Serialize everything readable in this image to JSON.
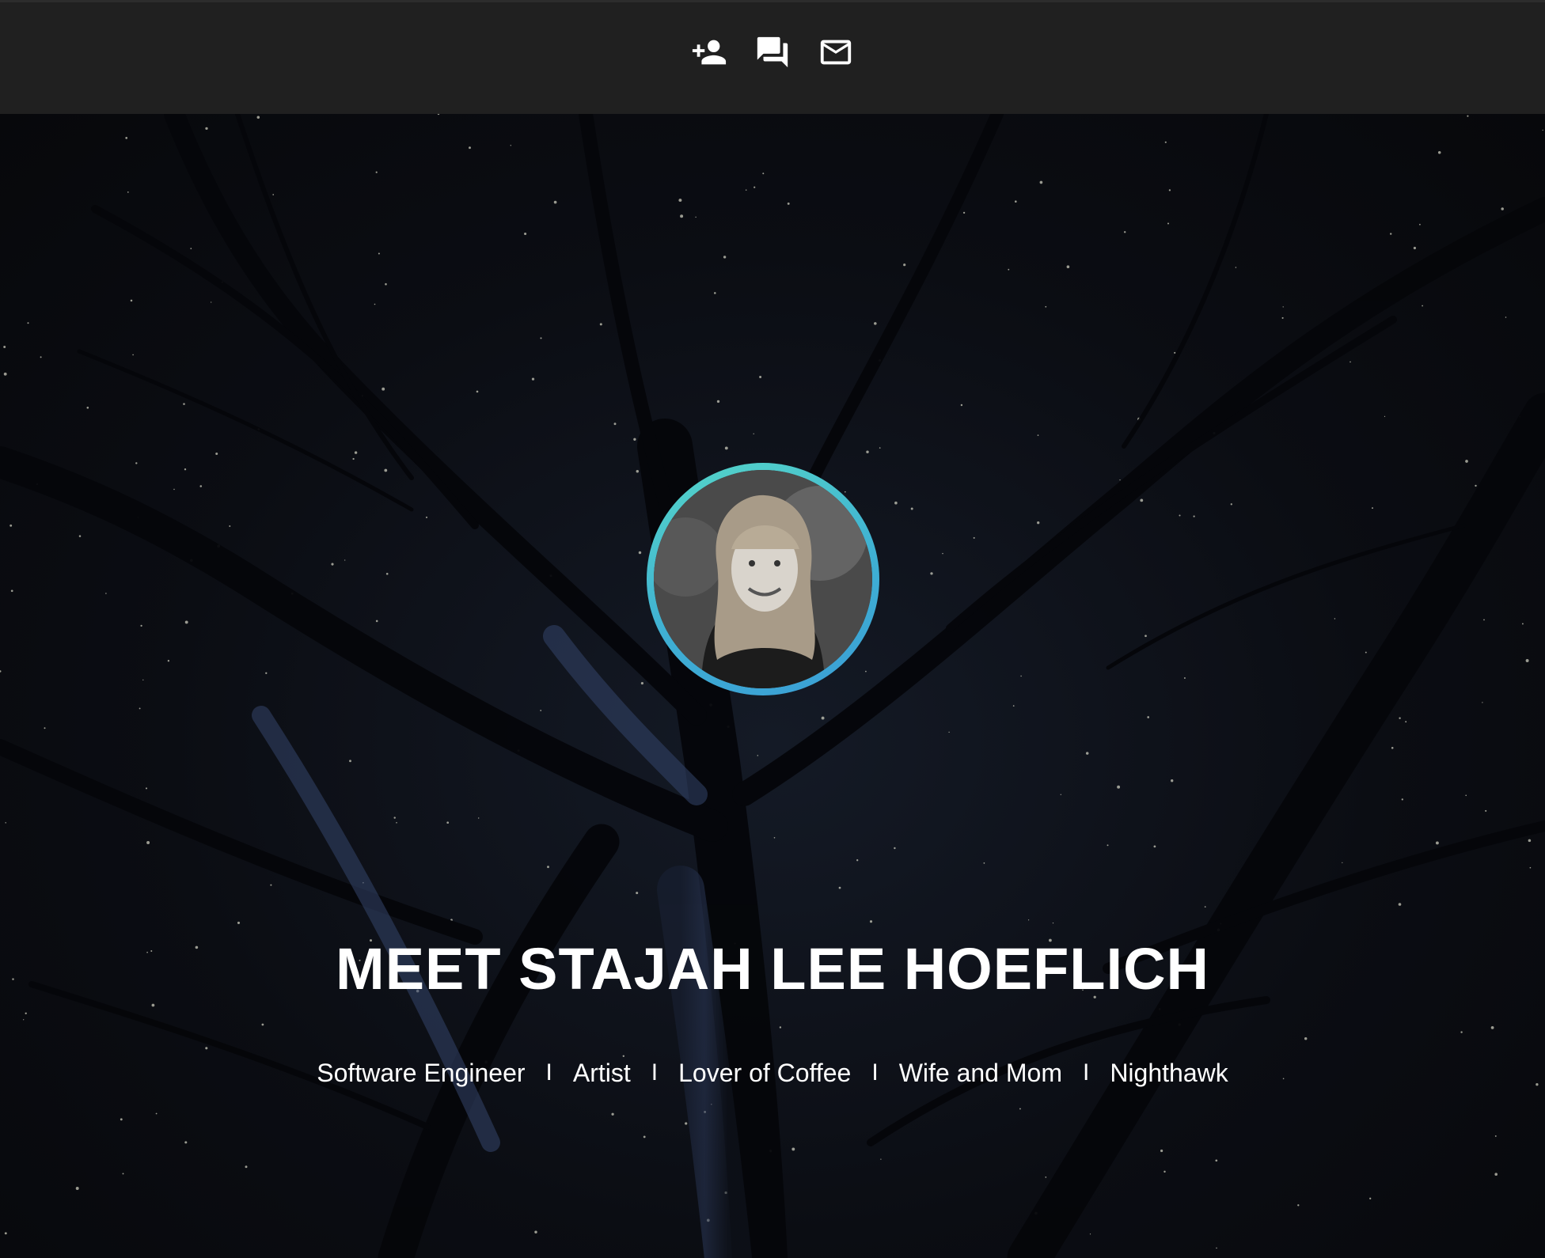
{
  "navbar": {
    "icons": [
      {
        "name": "person-add-icon"
      },
      {
        "name": "chat-icon"
      },
      {
        "name": "mail-icon"
      }
    ]
  },
  "hero": {
    "title": "MEET STAJAH LEE HOEFLICH",
    "taglines": [
      "Software Engineer",
      "Artist",
      "Lover of Coffee",
      "Wife and Mom",
      "Nighthawk"
    ],
    "separator": "I"
  },
  "colors": {
    "navbar_bg": "#202020",
    "ring_start": "#55d6c8",
    "ring_end": "#3a9ed6",
    "text": "#ffffff"
  }
}
